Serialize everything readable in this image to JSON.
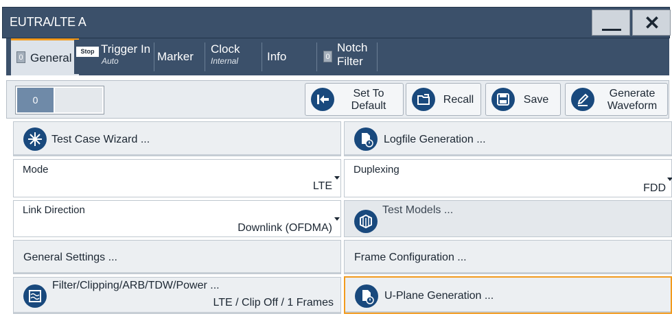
{
  "window": {
    "title": "EUTRA/LTE A",
    "minimize_glyph": "",
    "close_glyph": "✕"
  },
  "tabs": [
    {
      "label": "General",
      "sub": "",
      "led": "0",
      "badge": ""
    },
    {
      "label": "Trigger In",
      "sub": "Auto",
      "led": "",
      "badge": "Stop"
    },
    {
      "label": "Marker",
      "sub": "",
      "led": "",
      "badge": ""
    },
    {
      "label": "Clock",
      "sub": "Internal",
      "led": "",
      "badge": ""
    },
    {
      "label": "Info",
      "sub": "",
      "led": "",
      "badge": ""
    },
    {
      "label_line1": "Notch",
      "label_line2": "Filter",
      "led": "0"
    }
  ],
  "toolbar": {
    "state_value": "0",
    "set_to_default_line1": "Set To",
    "set_to_default_line2": "Default",
    "recall": "Recall",
    "save": "Save",
    "generate_waveform_line1": "Generate",
    "generate_waveform_line2": "Waveform"
  },
  "grid": {
    "test_case_wizard": "Test Case Wizard ...",
    "logfile_generation": "Logfile Generation ...",
    "mode_label": "Mode",
    "mode_value": "LTE",
    "duplexing_label": "Duplexing",
    "duplexing_value": "FDD",
    "link_direction_label": "Link Direction",
    "link_direction_value": "Downlink (OFDMA)",
    "test_models": "Test Models ...",
    "general_settings": "General Settings ...",
    "frame_configuration": "Frame Configuration ...",
    "filter_label": "Filter/Clipping/ARB/TDW/Power ...",
    "filter_value": "LTE / Clip Off / 1 Frames",
    "uplane_generation": "U-Plane Generation ..."
  },
  "colors": {
    "titlebar": "#3b506a",
    "accent": "#f29a1d",
    "icon_blue": "#19497d"
  }
}
